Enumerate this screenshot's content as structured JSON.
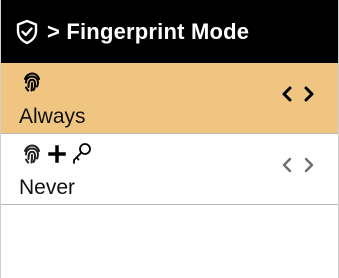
{
  "header": {
    "title": "> Fingerprint Mode",
    "icon": "shield-check-icon"
  },
  "options": [
    {
      "label": "Always",
      "icons": [
        "fingerprint-icon"
      ],
      "selected": true
    },
    {
      "label": "Never",
      "icons": [
        "fingerprint-icon",
        "plus-icon",
        "key-icon"
      ],
      "selected": false
    }
  ],
  "colors": {
    "header_bg": "#000000",
    "selected_bg": "#f0c581",
    "text": "#111111",
    "arrow_inactive": "#6e6e6e"
  }
}
